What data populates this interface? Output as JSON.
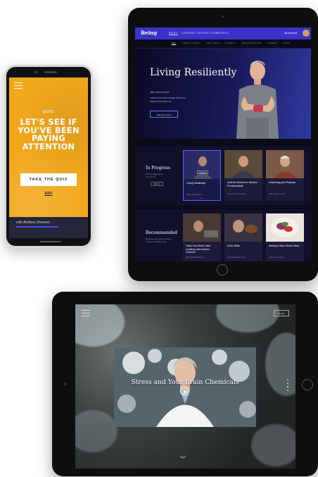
{
  "phone": {
    "kicker": "QUIZ",
    "title": "LET'S SEE IF YOU'VE BEEN PAYING ATTENTION",
    "quiz_button": "TAKE THE QUIZ",
    "exit_link": "EXIT",
    "bottom_text": "with Andrew Zimmern",
    "accent": "#f2a81d"
  },
  "tablet_top": {
    "brand": "Being",
    "nav": [
      "BEING",
      "COURSES",
      "INSTRUCTORS",
      "SEARCH"
    ],
    "account": "My Account",
    "subnav": [
      "ALL",
      "MIND & SPIRIT",
      "WELLNESS",
      "FITNESS",
      "RELATIONSHIPS",
      "CAREER",
      "FOOD"
    ],
    "hero": {
      "title": "Living Resiliently",
      "subtitle": "with Laurie Evans",
      "description": "Learn to not only manage stress but improve because of it.",
      "button": "Take the course"
    },
    "in_progress": {
      "title": "In Progress",
      "description": "Pick up right where you left off.",
      "button": "SEE ALL",
      "cards": [
        {
          "title": "Living Resiliently",
          "sub": "with Laurie Evans",
          "badge": "RESUME"
        },
        {
          "title": "Andrew Zimmern's Kitchen Fundamentals",
          "sub": "with Andrew Zimmern"
        },
        {
          "title": "Unlocking your Purpose",
          "sub": "with Joseph Lowry"
        }
      ]
    },
    "recommended": {
      "title": "Recommended",
      "description": "Because you took Andrew's Kitchen Fundamentals",
      "cards": [
        {
          "title": "Taste Your Work: Wok Cooking with Andrew Zimmern",
          "sub": "with Andrew Zimmern"
        },
        {
          "title": "Knife Skills",
          "sub": "with Andrew Zimmern"
        },
        {
          "title": "Making a Nice Dinner Meal",
          "sub": "with Chef Andrew"
        }
      ]
    },
    "accent": "#3a33c8"
  },
  "tablet_bottom": {
    "top_button": "IN SET",
    "video_title": "Stress and Your Brain Chemicals"
  }
}
